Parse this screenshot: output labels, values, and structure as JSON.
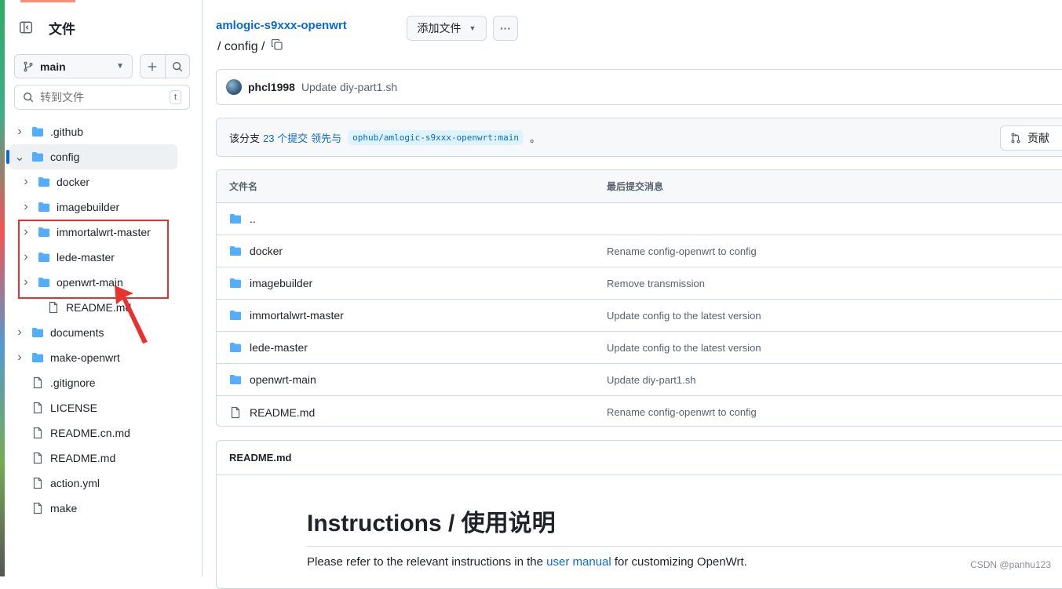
{
  "sidebar": {
    "title": "文件",
    "branch": "main",
    "search_placeholder": "转到文件",
    "search_shortcut": "t",
    "tree": [
      {
        "label": ".github",
        "type": "folder",
        "depth": 0,
        "expanded": false
      },
      {
        "label": "config",
        "type": "folder",
        "depth": 0,
        "expanded": true,
        "active": true
      },
      {
        "label": "docker",
        "type": "folder",
        "depth": 1,
        "expanded": false
      },
      {
        "label": "imagebuilder",
        "type": "folder",
        "depth": 1,
        "expanded": false
      },
      {
        "label": "immortalwrt-master",
        "type": "folder",
        "depth": 1,
        "expanded": false
      },
      {
        "label": "lede-master",
        "type": "folder",
        "depth": 1,
        "expanded": false
      },
      {
        "label": "openwrt-main",
        "type": "folder",
        "depth": 1,
        "expanded": false
      },
      {
        "label": "README.md",
        "type": "file",
        "depth": 1
      },
      {
        "label": "documents",
        "type": "folder",
        "depth": 0,
        "expanded": false
      },
      {
        "label": "make-openwrt",
        "type": "folder",
        "depth": 0,
        "expanded": false
      },
      {
        "label": ".gitignore",
        "type": "file",
        "depth": 0
      },
      {
        "label": "LICENSE",
        "type": "file",
        "depth": 0
      },
      {
        "label": "README.cn.md",
        "type": "file",
        "depth": 0
      },
      {
        "label": "README.md",
        "type": "file",
        "depth": 0
      },
      {
        "label": "action.yml",
        "type": "file",
        "depth": 0
      },
      {
        "label": "make",
        "type": "file",
        "depth": 0
      }
    ]
  },
  "header": {
    "repo": "amlogic-s9xxx-openwrt",
    "path": "/ config /",
    "add_file_label": "添加文件",
    "more_label": "···"
  },
  "commit": {
    "author": "phcl1998",
    "message": "Update diy-part1.sh"
  },
  "branch_info": {
    "prefix": "该分支",
    "commits_link": "23 个提交",
    "ahead_text": "领先与",
    "upstream": "ophub/amlogic-s9xxx-openwrt:main",
    "suffix": "。",
    "contribute_label": "贡献"
  },
  "file_table": {
    "col_name": "文件名",
    "col_msg": "最后提交消息",
    "rows": [
      {
        "name": "..",
        "type": "folder",
        "msg": ""
      },
      {
        "name": "docker",
        "type": "folder",
        "msg": "Rename config-openwrt to config"
      },
      {
        "name": "imagebuilder",
        "type": "folder",
        "msg": "Remove transmission"
      },
      {
        "name": "immortalwrt-master",
        "type": "folder",
        "msg": "Update config to the latest version"
      },
      {
        "name": "lede-master",
        "type": "folder",
        "msg": "Update config to the latest version"
      },
      {
        "name": "openwrt-main",
        "type": "folder",
        "msg": "Update diy-part1.sh"
      },
      {
        "name": "README.md",
        "type": "file",
        "msg": "Rename config-openwrt to config"
      }
    ]
  },
  "readme": {
    "title": "README.md",
    "h1": "Instructions / 使用说明",
    "p_before": "Please refer to the relevant instructions in the ",
    "p_link": "user manual",
    "p_after": " for customizing OpenWrt."
  },
  "watermark": "CSDN @panhu123",
  "colors": {
    "folder": "#54aeff",
    "link": "#0969da",
    "annotation": "#e8322f"
  }
}
